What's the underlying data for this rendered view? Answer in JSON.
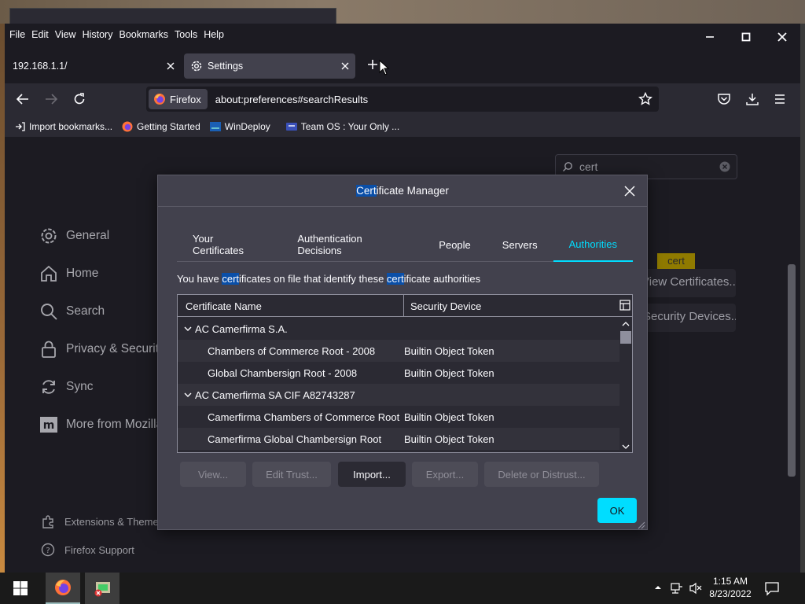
{
  "menubar": {
    "items": [
      "File",
      "Edit",
      "View",
      "History",
      "Bookmarks",
      "Tools",
      "Help"
    ]
  },
  "tabs": [
    {
      "label": "192.168.1.1/"
    },
    {
      "label": "Settings"
    }
  ],
  "urlbar": {
    "identity": "Firefox",
    "url": "about:preferences#searchResults"
  },
  "bookmarks": [
    {
      "label": "Import bookmarks..."
    },
    {
      "label": "Getting Started"
    },
    {
      "label": "WinDeploy"
    },
    {
      "label": "Team OS : Your Only ..."
    }
  ],
  "prefs": {
    "search_value": "cert",
    "sidebar": [
      "General",
      "Home",
      "Search",
      "Privacy & Security",
      "Sync",
      "More from Mozilla"
    ],
    "footer": [
      "Extensions & Themes",
      "Firefox Support"
    ],
    "bg_button1": "View Certificates...",
    "bg_button2": "Security Devices...",
    "tooltip": "cert"
  },
  "dialog": {
    "title_hl": "Cert",
    "title_rest": "ificate Manager",
    "tabs": [
      "Your Certificates",
      "Authentication Decisions",
      "People",
      "Servers",
      "Authorities"
    ],
    "active_tab": "Authorities",
    "desc_parts": [
      "You have ",
      "cert",
      "ificates on file that identify these ",
      "cert",
      "ificate authorities"
    ],
    "columns": [
      "Certificate Name",
      "Security Device"
    ],
    "rows": [
      {
        "name": "AC Camerfirma S.A.",
        "device": "",
        "group": true
      },
      {
        "name": "Chambers of Commerce Root - 2008",
        "device": "Builtin Object Token",
        "group": false
      },
      {
        "name": "Global Chambersign Root - 2008",
        "device": "Builtin Object Token",
        "group": false
      },
      {
        "name": "AC Camerfirma SA CIF A82743287",
        "device": "",
        "group": true
      },
      {
        "name": "Camerfirma Chambers of Commerce Root",
        "device": "Builtin Object Token",
        "group": false
      },
      {
        "name": "Camerfirma Global Chambersign Root",
        "device": "Builtin Object Token",
        "group": false
      }
    ],
    "buttons": {
      "view": "View...",
      "edit": "Edit Trust...",
      "import": "Import...",
      "export": "Export...",
      "delete": "Delete or Distrust...",
      "ok": "OK"
    }
  },
  "taskbar": {
    "time": "1:15 AM",
    "date": "8/23/2022"
  },
  "colors": {
    "accent": "#00ddff",
    "highlight": "#0a4fa8",
    "dialog_bg": "#42414d"
  }
}
